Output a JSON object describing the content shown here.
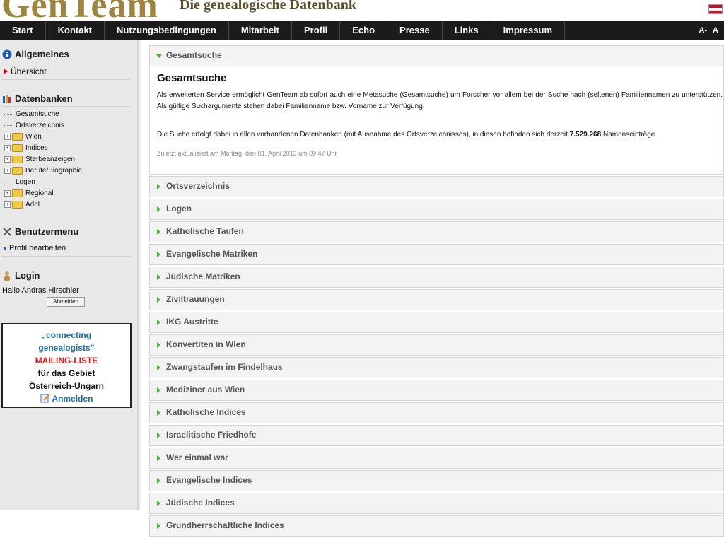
{
  "header": {
    "logo": "GenTeam",
    "tagline": "Die genealogische Datenbank"
  },
  "nav": {
    "items": [
      "Start",
      "Kontakt",
      "Nutzungsbedingungen",
      "Mitarbeit",
      "Profil",
      "Echo",
      "Presse",
      "Links",
      "Impressum"
    ],
    "fontsize_small": "A-",
    "fontsize_large": "A"
  },
  "sidebar": {
    "allgemeines_title": "Allgemeines",
    "uebersicht": "Übersicht",
    "datenbanken_title": "Datenbanken",
    "tree": [
      {
        "label": "Gesamtsuche",
        "folder": false
      },
      {
        "label": "Ortsverzeichnis",
        "folder": false
      },
      {
        "label": "Wien",
        "folder": true
      },
      {
        "label": "Indices",
        "folder": true
      },
      {
        "label": "Sterbeanzeigen",
        "folder": true
      },
      {
        "label": "Berufe/Biographie",
        "folder": true
      },
      {
        "label": "Logen",
        "folder": false
      },
      {
        "label": "Regional",
        "folder": true
      },
      {
        "label": "Adel",
        "folder": true
      }
    ],
    "benutzermenu_title": "Benutzermenu",
    "profil_bearbeiten": "Profil bearbeiten",
    "login_title": "Login",
    "hello": "Hallo Andras Hirschler",
    "logout": "Abmelden",
    "promo": {
      "line1": "„connecting",
      "line2": "genealogists”",
      "line3": "MAILING-LISTE",
      "line4": "für das Gebiet",
      "line5": "Österreich-Ungarn",
      "line6": "Anmelden"
    }
  },
  "content": {
    "open_section": "Gesamtsuche",
    "heading": "Gesamtsuche",
    "paragraph1": "Als erweiterten Service ermöglicht GenTeam ab sofort auch eine Metasuche (Gesamtsuche) um Forscher vor allem bei der Suche nach (seltenen) Familiennamen zu unterstützen. Als gültige Suchargumente stehen dabei Familienname bzw. Vorname zur Verfügung.",
    "paragraph2_before": "Die Suche erfolgt dabei in allen vorhandenen Datenbanken (mit Ausnahme des Ortsverzeichnisses), in diesen befinden sich derzeit",
    "paragraph2_count": "7.529.268",
    "paragraph2_after": "Namenseinträge.",
    "updated": "Zuletzt aktualisiert am Montag, den 01. April 2013 um 09:47 Uhr",
    "sections": [
      "Ortsverzeichnis",
      "Logen",
      "Katholische Taufen",
      "Evangelische Matriken",
      "Jüdische Matriken",
      "Ziviltrauungen",
      "IKG Austritte",
      "Konvertiten in WIen",
      "Zwangstaufen im Findelhaus",
      "Mediziner aus Wien",
      "Katholische Indices",
      "Israelitische Friedhöfe",
      "Wer einmal war",
      "Evangelische Indices",
      "Jüdische Indices",
      "Grundherrschaftliche Indices"
    ]
  }
}
